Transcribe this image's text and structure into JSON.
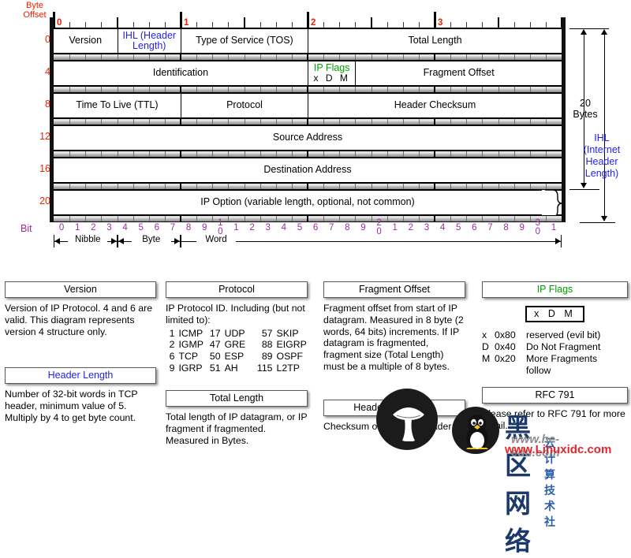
{
  "diagram": {
    "byte_offset_label": "Byte\nOffset",
    "bit_label": "Bit",
    "byte_offsets": [
      "0",
      "4",
      "8",
      "12",
      "16",
      "20"
    ],
    "top_ruler_numbers": [
      "0",
      "1",
      "2",
      "3"
    ],
    "bit_numbers": [
      "0",
      "1",
      "2",
      "3",
      "4",
      "5",
      "6",
      "7",
      "8",
      "9",
      "1\n0",
      "1",
      "2",
      "3",
      "4",
      "5",
      "6",
      "7",
      "8",
      "9",
      "2\n0",
      "1",
      "2",
      "3",
      "4",
      "5",
      "6",
      "7",
      "8",
      "9",
      "3\n0",
      "1"
    ],
    "span_labels": [
      "Nibble",
      "Byte",
      "Word"
    ],
    "rows": [
      {
        "offset": "0",
        "cells": [
          {
            "label": "Version",
            "color": "black"
          },
          {
            "label": "IHL (Header Length)",
            "color": "blue"
          },
          {
            "label": "Type of Service (TOS)",
            "color": "black"
          },
          {
            "label": "Total Length",
            "color": "black"
          }
        ]
      },
      {
        "offset": "4",
        "cells": [
          {
            "label": "Identification",
            "color": "black"
          },
          {
            "label": "IP Flags",
            "sub": "x  D  M",
            "color": "green"
          },
          {
            "label": "Fragment Offset",
            "color": "black"
          }
        ]
      },
      {
        "offset": "8",
        "cells": [
          {
            "label": "Time To Live (TTL)",
            "color": "black"
          },
          {
            "label": "Protocol",
            "color": "black"
          },
          {
            "label": "Header Checksum",
            "color": "black"
          }
        ]
      },
      {
        "offset": "12",
        "cells": [
          {
            "label": "Source Address",
            "color": "black"
          }
        ]
      },
      {
        "offset": "16",
        "cells": [
          {
            "label": "Destination Address",
            "color": "black"
          }
        ]
      },
      {
        "offset": "20",
        "cells": [
          {
            "label": "IP Option (variable length, optional, not common)",
            "color": "black"
          }
        ]
      }
    ],
    "measures": [
      {
        "label": "20\nBytes",
        "color": "black"
      },
      {
        "label": "IHL\n(Internet\nHeader\nLength)",
        "color": "blue"
      }
    ]
  },
  "legend": {
    "version": {
      "title": "Version",
      "title_color": "black",
      "body": "Version of IP Protocol.  4 and 6 are valid.  This diagram represents version 4 structure only."
    },
    "header_length": {
      "title": "Header Length",
      "title_color": "blue",
      "body": "Number of 32-bit words in TCP header, minimum value of 5.  Multiply by 4 to get byte count."
    },
    "protocol": {
      "title": "Protocol",
      "title_color": "black",
      "body": "IP Protocol ID.  Including (but not limited to):",
      "table": [
        [
          "1",
          "ICMP",
          "17",
          "UDP",
          "57",
          "SKIP"
        ],
        [
          "2",
          "IGMP",
          "47",
          "GRE",
          "88",
          "EIGRP"
        ],
        [
          "6",
          "TCP",
          "50",
          "ESP",
          "89",
          "OSPF"
        ],
        [
          "9",
          "IGRP",
          "51",
          "AH",
          "115",
          "L2TP"
        ]
      ]
    },
    "total_length": {
      "title": "Total Length",
      "title_color": "black",
      "body": "Total length of IP datagram, or IP fragment if fragmented. Measured in Bytes."
    },
    "fragment_offset": {
      "title": "Fragment Offset",
      "title_color": "black",
      "body": "Fragment offset from start of IP datagram.  Measured in 8 byte (2 words, 64 bits) increments.  If IP datagram is fragmented, fragment size (Total Length) must be a multiple of 8 bytes."
    },
    "header_checksum": {
      "title": "Header Checksum",
      "title_color": "black",
      "body": "Checksum of entire IP header"
    },
    "ip_flags": {
      "title": "IP Flags",
      "title_color": "green",
      "flag_box": "x  D  M",
      "rows": [
        [
          "x",
          "0x80",
          "reserved (evil bit)"
        ],
        [
          "D",
          "0x40",
          "Do Not Fragment"
        ],
        [
          "M",
          "0x20",
          "More Fragments"
        ],
        [
          "",
          "",
          "follow"
        ]
      ]
    },
    "rfc": {
      "title": "RFC 791",
      "title_color": "black",
      "body": "Please refer to RFC 791 for more detail."
    }
  },
  "watermarks": {
    "chinese": "黑区网络",
    "chinese_sub": "云计算技术社",
    "site_gray": "www.he-edu.com",
    "site_red": "www.Linuxidc.com"
  }
}
